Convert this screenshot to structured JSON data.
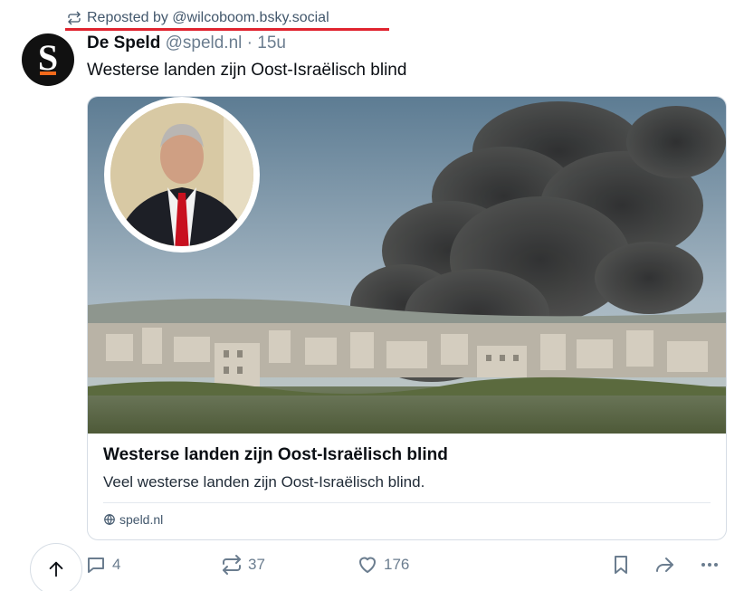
{
  "repost": {
    "icon": "repost-icon",
    "text": "Reposted by @wilcoboom.bsky.social"
  },
  "author": {
    "avatar_letter": "S",
    "display_name": "De Speld",
    "handle": "@speld.nl",
    "separator": "·",
    "time": "15u"
  },
  "post": {
    "text": "Westerse landen zijn Oost-Israëlisch blind"
  },
  "card": {
    "title": "Westerse landen zijn Oost-Israëlisch blind",
    "description": "Veel westerse landen zijn Oost-Israëlisch blind.",
    "domain": "speld.nl"
  },
  "actions": {
    "replies": "4",
    "reposts": "37",
    "likes": "176"
  },
  "colors": {
    "text": "#0b0f14",
    "muted": "#6b7d8f",
    "border": "#d6dde5",
    "highlight_underline": "#e0242f",
    "avatar_accent": "#f26a1b"
  }
}
